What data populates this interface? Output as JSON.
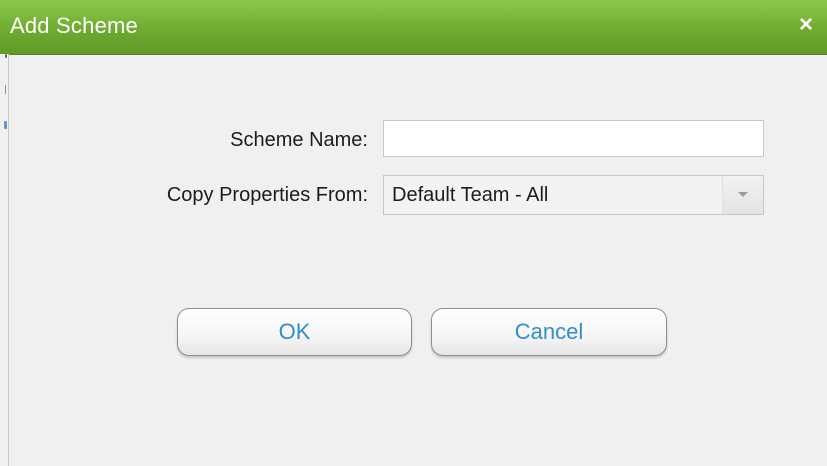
{
  "dialog": {
    "title": "Add Scheme",
    "close_icon": "close-icon"
  },
  "form": {
    "scheme_name_label": "Scheme Name:",
    "scheme_name_value": "",
    "copy_from_label": "Copy Properties From:",
    "copy_from_value": "Default Team - All",
    "dropdown_icon": "chevron-down-icon"
  },
  "buttons": {
    "ok_label": "OK",
    "cancel_label": "Cancel"
  },
  "colors": {
    "titlebar": "#6fab31",
    "button_text": "#2f8fcb",
    "background": "#f0f0f0"
  }
}
